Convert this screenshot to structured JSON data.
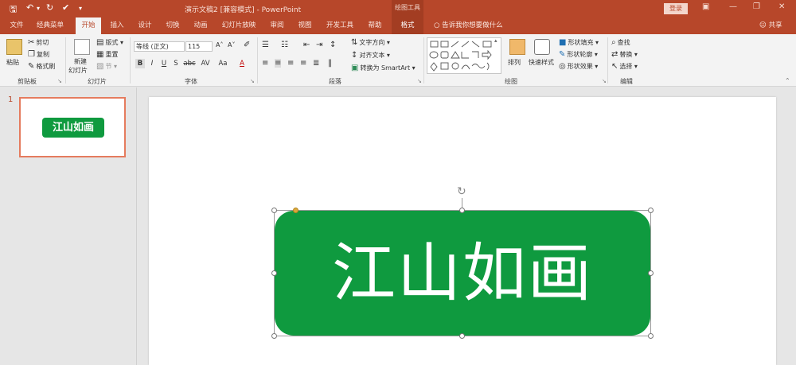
{
  "titlebar": {
    "document_title": "演示文稿2 [兼容模式] - PowerPoint",
    "context_tools": "绘图工具",
    "login": "登录",
    "qat_save_icon": "save-icon",
    "qat_undo_icon": "undo-icon",
    "qat_redo_icon": "redo-icon",
    "qat_spell_icon": "spellcheck-icon"
  },
  "tabs": [
    "文件",
    "经典菜单",
    "开始",
    "插入",
    "设计",
    "切换",
    "动画",
    "幻灯片放映",
    "审阅",
    "视图",
    "开发工具",
    "帮助",
    "格式"
  ],
  "tell_me": "告诉我你想要做什么",
  "share": "共享",
  "ribbon": {
    "clipboard": {
      "label": "剪贴板",
      "paste": "粘贴",
      "cut": "剪切",
      "copy": "复制",
      "format_painter": "格式刷"
    },
    "slides": {
      "label": "幻灯片",
      "new_slide": "新建",
      "new_slide2": "幻灯片",
      "layout": "版式",
      "reset": "重置",
      "section": "节"
    },
    "font": {
      "label": "字体",
      "font_name": "等线 (正文)",
      "font_size": "115",
      "bold": "B",
      "italic": "I",
      "underline": "U",
      "shadow": "S",
      "strike": "abc",
      "spacing": "AV",
      "case": "Aa",
      "color": "A"
    },
    "paragraph": {
      "label": "段落",
      "text_direction": "文字方向",
      "align_text": "对齐文本",
      "smartart": "转换为 SmartArt"
    },
    "drawing": {
      "label": "绘图",
      "arrange": "排列",
      "quick_styles": "快速样式",
      "fill": "形状填充",
      "outline": "形状轮廓",
      "effects": "形状效果"
    },
    "editing": {
      "label": "编辑",
      "find": "查找",
      "replace": "替换",
      "select": "选择"
    }
  },
  "thumbnails": {
    "slide_number": "1",
    "text": "江山如画"
  },
  "slide": {
    "shape_text": "江山如画"
  },
  "colors": {
    "accent": "#b7472a",
    "shape_fill": "#0f9a3f"
  }
}
